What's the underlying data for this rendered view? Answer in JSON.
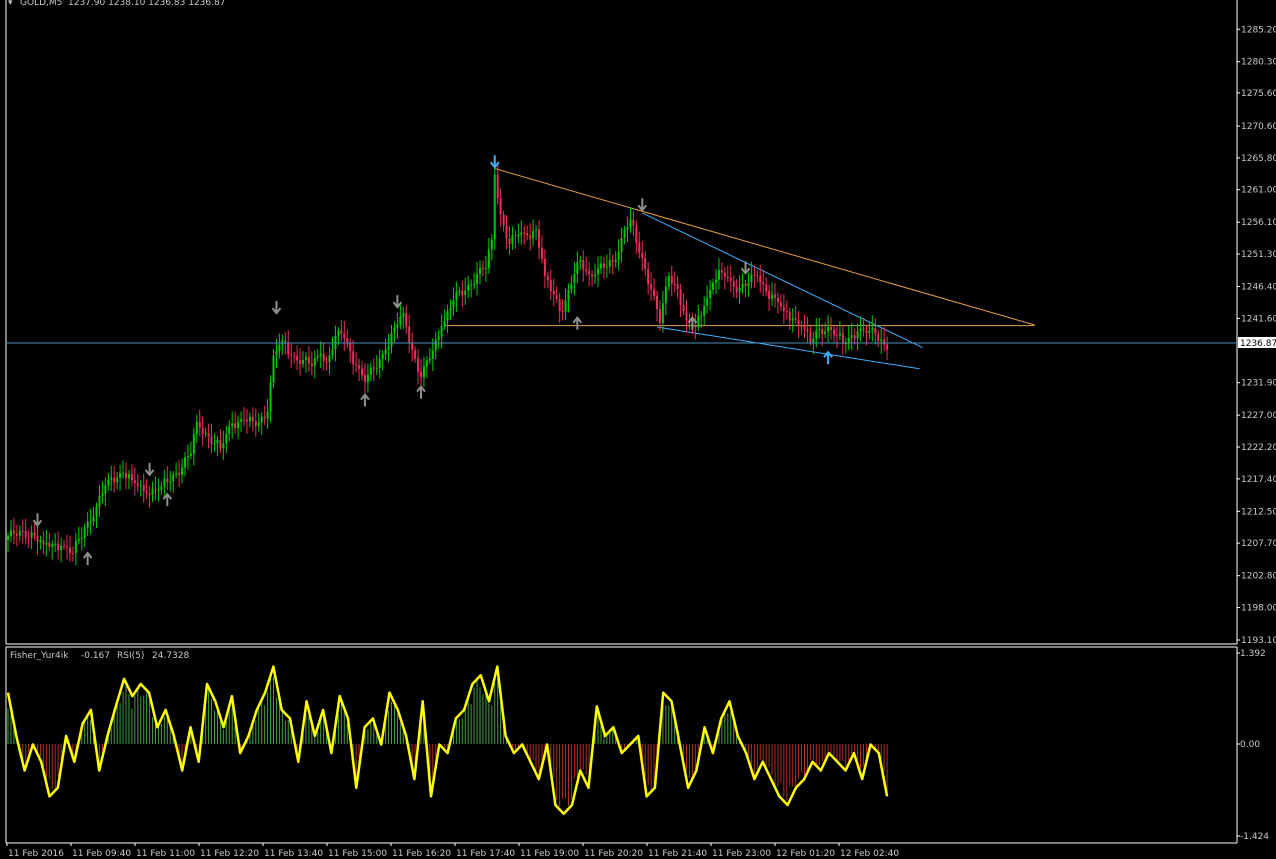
{
  "header": {
    "symbol": "GOLD,M5",
    "ohlc_text": "1237.90 1238.10 1236.83 1236.87"
  },
  "indicator_header": {
    "name1": "Fisher_Yur4ik",
    "value1": "-0.167",
    "name2": "RSI(5)",
    "value2": "24.7328"
  },
  "current_price_label": "1236.87",
  "colors": {
    "background": "#000000",
    "bull_candle": "#00c800",
    "bear_candle": "#e8305a",
    "grid_frame": "#ffffff",
    "upper_trendline": "#e8a040",
    "wedge_lines": "#3cb0ff",
    "current_price_line": "#5090c0",
    "fractal_arrow": "#909090",
    "rsi_line": "#ffff00",
    "fisher_pos": "#40a040",
    "fisher_neg": "#b03020"
  },
  "chart_data": [
    {
      "type": "candlestick",
      "title": "GOLD,M5",
      "y_ticks": [
        "1285.20",
        "1280.30",
        "1275.60",
        "1270.60",
        "1265.80",
        "1261.00",
        "1256.10",
        "1251.30",
        "1246.40",
        "1241.60",
        "1231.90",
        "1227.00",
        "1222.20",
        "1217.40",
        "1212.50",
        "1207.70",
        "1202.80",
        "1198.00",
        "1193.10"
      ],
      "ylim": [
        1193.1,
        1287.5
      ],
      "x_ticks": [
        "11 Feb 2016",
        "11 Feb 09:40",
        "11 Feb 11:00",
        "11 Feb 12:20",
        "11 Feb 13:40",
        "11 Feb 15:00",
        "11 Feb 16:20",
        "11 Feb 17:40",
        "11 Feb 19:00",
        "11 Feb 20:20",
        "11 Feb 21:40",
        "11 Feb 23:00",
        "12 Feb 01:20",
        "12 Feb 02:40"
      ],
      "close_key_points": [
        [
          0,
          1208.8
        ],
        [
          8,
          1209.3
        ],
        [
          12,
          1207.5
        ],
        [
          18,
          1207.3
        ],
        [
          22,
          1206.2
        ],
        [
          26,
          1210.0
        ],
        [
          30,
          1213.2
        ],
        [
          34,
          1217.3
        ],
        [
          39,
          1218.3
        ],
        [
          42,
          1217.2
        ],
        [
          47,
          1215.2
        ],
        [
          52,
          1216.2
        ],
        [
          57,
          1218.3
        ],
        [
          62,
          1221.2
        ],
        [
          64,
          1226.0
        ],
        [
          68,
          1223.8
        ],
        [
          72,
          1222.0
        ],
        [
          76,
          1225.8
        ],
        [
          80,
          1226.3
        ],
        [
          84,
          1225.4
        ],
        [
          88,
          1227.6
        ],
        [
          90,
          1236.0
        ],
        [
          93,
          1238.3
        ],
        [
          96,
          1236.0
        ],
        [
          100,
          1235.3
        ],
        [
          103,
          1234.4
        ],
        [
          106,
          1236.3
        ],
        [
          108,
          1235.0
        ],
        [
          112,
          1239.8
        ],
        [
          114,
          1238.6
        ],
        [
          118,
          1234.5
        ],
        [
          121,
          1232.0
        ],
        [
          124,
          1234.0
        ],
        [
          128,
          1236.9
        ],
        [
          132,
          1240.7
        ],
        [
          134,
          1242.4
        ],
        [
          137,
          1236.8
        ],
        [
          140,
          1232.7
        ],
        [
          143,
          1235.5
        ],
        [
          147,
          1240.4
        ],
        [
          151,
          1244.4
        ],
        [
          155,
          1245.8
        ],
        [
          159,
          1248.3
        ],
        [
          162,
          1249.2
        ],
        [
          164,
          1253.5
        ],
        [
          165,
          1263.3
        ],
        [
          167,
          1257.3
        ],
        [
          170,
          1252.8
        ],
        [
          173,
          1254.2
        ],
        [
          176,
          1254.1
        ],
        [
          179,
          1255.0
        ],
        [
          182,
          1248.0
        ],
        [
          185,
          1245.2
        ],
        [
          188,
          1242.6
        ],
        [
          191,
          1246.9
        ],
        [
          194,
          1250.4
        ],
        [
          197,
          1248.2
        ],
        [
          200,
          1249.1
        ],
        [
          203,
          1249.4
        ],
        [
          206,
          1250.5
        ],
        [
          209,
          1255.0
        ],
        [
          211,
          1256.5
        ],
        [
          213,
          1253.0
        ],
        [
          216,
          1249.0
        ],
        [
          219,
          1245.0
        ],
        [
          221,
          1240.9
        ],
        [
          224,
          1248.0
        ],
        [
          227,
          1246.0
        ],
        [
          230,
          1241.3
        ],
        [
          233,
          1240.3
        ],
        [
          236,
          1243.5
        ],
        [
          239,
          1247.0
        ],
        [
          242,
          1248.5
        ],
        [
          245,
          1247.2
        ],
        [
          248,
          1246.2
        ],
        [
          251,
          1247.0
        ],
        [
          254,
          1248.0
        ],
        [
          257,
          1245.7
        ],
        [
          260,
          1244.7
        ],
        [
          263,
          1242.7
        ],
        [
          266,
          1241.6
        ],
        [
          269,
          1240.4
        ],
        [
          272,
          1238.0
        ],
        [
          275,
          1240.0
        ],
        [
          278,
          1240.3
        ],
        [
          281,
          1239.0
        ],
        [
          283,
          1237.8
        ],
        [
          285,
          1238.7
        ],
        [
          288,
          1239.7
        ],
        [
          291,
          1239.4
        ],
        [
          294,
          1239.3
        ],
        [
          296,
          1238.4
        ],
        [
          298,
          1236.87
        ]
      ],
      "trendlines": [
        {
          "name": "upper",
          "from": [
            165,
            1264.2
          ],
          "to": [
            348,
            1240.6
          ]
        },
        {
          "name": "horizontal-resistance",
          "from": [
            148,
            1240.5
          ],
          "to": [
            348,
            1240.5
          ]
        },
        {
          "name": "wedge-top",
          "from": [
            215,
            1257.5
          ],
          "to": [
            310,
            1237.2
          ]
        },
        {
          "name": "wedge-bottom",
          "from": [
            220,
            1240.3
          ],
          "to": [
            309,
            1234.0
          ]
        }
      ],
      "fractals_down": [
        [
          10,
          1211.0
        ],
        [
          48,
          1218.6
        ],
        [
          91,
          1243.0
        ],
        [
          132,
          1243.9
        ],
        [
          165,
          1265.0
        ],
        [
          215,
          1258.5
        ],
        [
          250,
          1249.0
        ]
      ],
      "fractals_up": [
        [
          27,
          1205.6
        ],
        [
          54,
          1214.5
        ],
        [
          121,
          1229.5
        ],
        [
          140,
          1230.7
        ],
        [
          193,
          1241.1
        ],
        [
          232,
          1241.1
        ],
        [
          278,
          1235.9
        ]
      ]
    },
    {
      "type": "line",
      "title": "Fisher_Yur4ik / RSI(5)",
      "series": [
        {
          "name": "RSI(5)",
          "values": [
            80,
            55,
            35,
            50,
            40,
            20,
            25,
            55,
            40,
            62,
            70,
            35,
            55,
            72,
            88,
            78,
            85,
            80,
            60,
            70,
            55,
            35,
            60,
            40,
            85,
            75,
            60,
            78,
            45,
            55,
            70,
            80,
            95,
            70,
            65,
            40,
            75,
            55,
            70,
            45,
            78,
            65,
            25,
            60,
            65,
            50,
            80,
            70,
            55,
            30,
            75,
            20,
            50,
            45,
            65,
            70,
            85,
            90,
            75,
            95,
            55,
            45,
            50,
            40,
            30,
            50,
            15,
            10,
            15,
            35,
            25,
            72,
            55,
            60,
            45,
            50,
            55,
            20,
            25,
            80,
            75,
            50,
            25,
            35,
            60,
            45,
            65,
            75,
            55,
            45,
            30,
            40,
            30,
            20,
            15,
            25,
            30,
            40,
            35,
            45,
            40,
            35,
            45,
            30,
            50,
            45,
            20
          ]
        }
      ]
    }
  ]
}
